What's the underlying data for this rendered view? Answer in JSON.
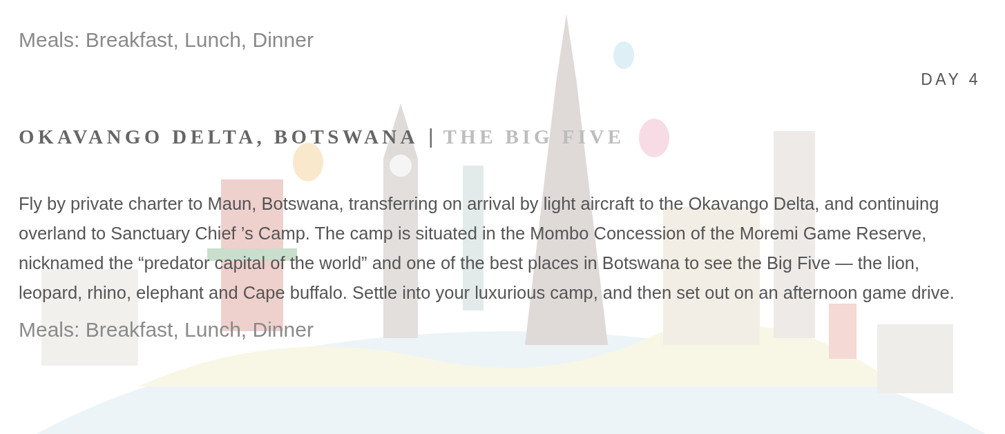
{
  "previous_day": {
    "meals": "Meals: Breakfast, Lunch, Dinner"
  },
  "day": {
    "label": "DAY 4",
    "heading": {
      "place": "OKAVANGO DELTA, BOTSWANA",
      "separator": "|",
      "theme": "THE BIG FIVE"
    },
    "description": "Fly by private charter to Maun, Botswana, transferring on arrival by light aircraft to the Okavango Delta, and continuing overland to Sanctuary Chief ’s Camp. The camp is situated in the Mombo Concession of the Moremi Game Reserve, nicknamed the “predator capital of the world” and one of the best places in Botswana to see the Big Five — the lion, leopard, rhino, elephant and Cape buffalo. Settle into your luxurious camp, and then set out on an afternoon game drive.",
    "meals": "Meals: Breakfast, Lunch, Dinner"
  }
}
